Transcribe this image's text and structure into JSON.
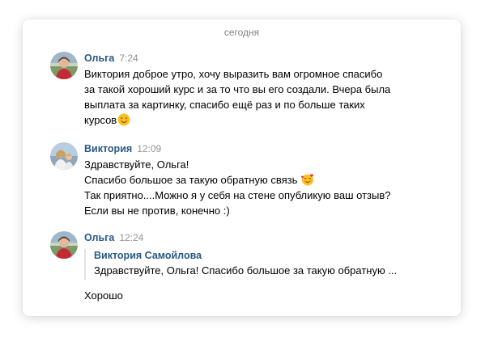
{
  "date_separator": "сегодня",
  "messages": [
    {
      "author": "Ольга",
      "time": "7:24",
      "lines": [
        "Виктория доброе утро, хочу выразить вам огромное спасибо",
        "за такой хороший курс и за то что вы его создали. Вчера была",
        "выплата за картинку, спасибо ещё раз и по больше таких",
        "курсов"
      ],
      "emoji": "smiling-blush-emoji"
    },
    {
      "author": "Виктория",
      "time": "12:09",
      "lines": [
        "Здравствуйте, Ольга!",
        "Спасибо большое за такую обратную связь",
        "Так приятно....Можно я у себя на стене опубликую ваш отзыв?",
        "Если вы не против, конечно :)"
      ],
      "emoji": "smiling-hearts-emoji"
    },
    {
      "author": "Ольга",
      "time": "12:24",
      "quote": {
        "author": "Виктория Самойлова",
        "text": "Здравствуйте, Ольга! Спасибо большое за такую обратную ..."
      },
      "reply": "Хорошо"
    }
  ],
  "colors": {
    "author": "#2a5885",
    "time": "#939393",
    "text": "#000000",
    "separator": "#828282"
  }
}
